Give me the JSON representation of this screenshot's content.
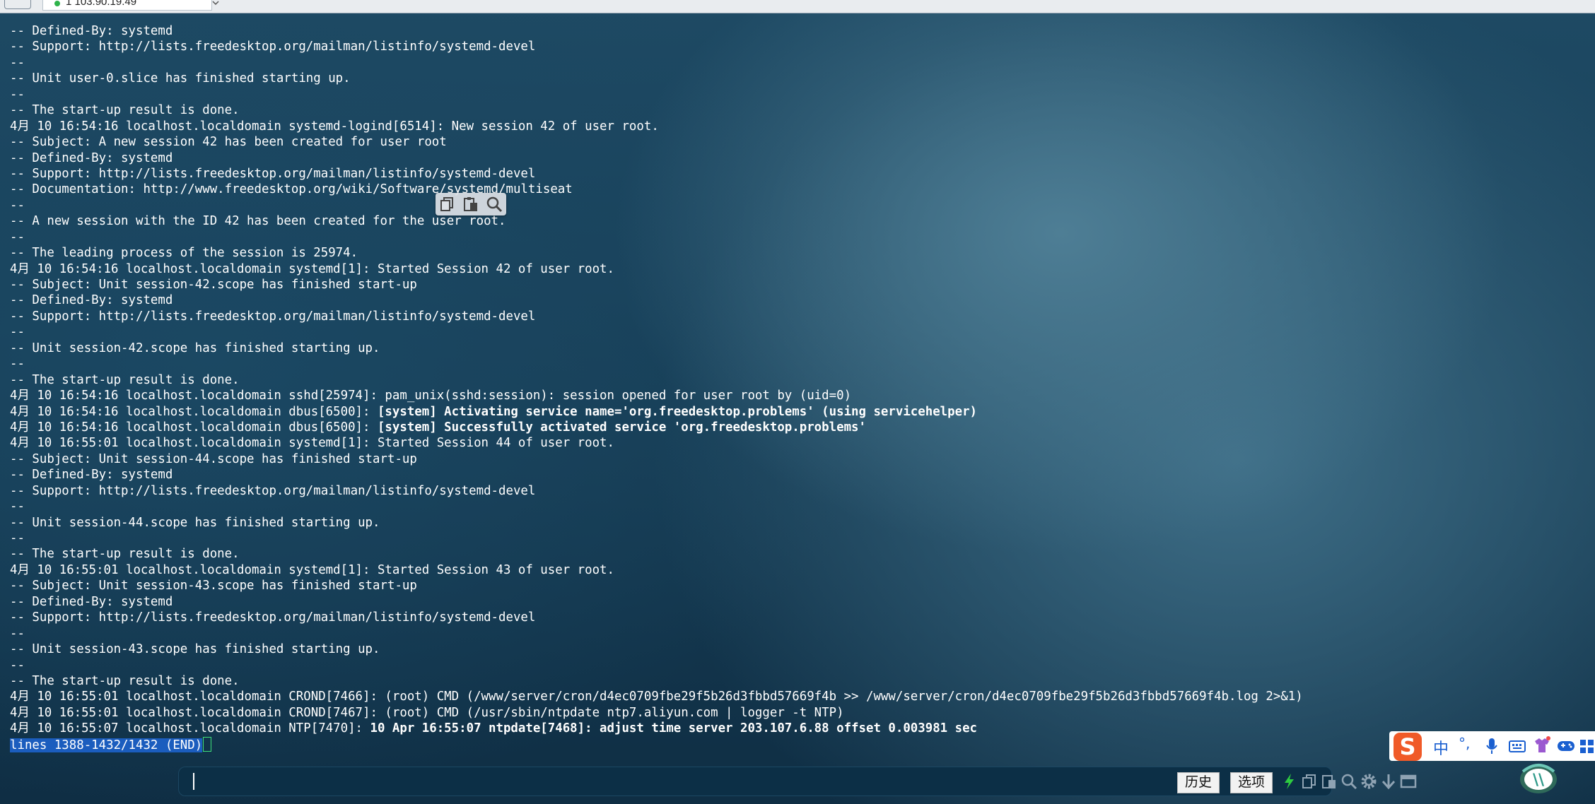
{
  "window": {
    "tab_title": "1 103.90.19.49",
    "active_tab_status_color": "#2fb34a"
  },
  "terminal": {
    "lines": [
      {
        "text": "-- Defined-By: systemd"
      },
      {
        "text": "-- Support: http://lists.freedesktop.org/mailman/listinfo/systemd-devel"
      },
      {
        "text": "--"
      },
      {
        "text": "-- Unit user-0.slice has finished starting up."
      },
      {
        "text": "--"
      },
      {
        "text": "-- The start-up result is done."
      },
      {
        "text": "4月 10 16:54:16 localhost.localdomain systemd-logind[6514]: New session 42 of user root."
      },
      {
        "text": "-- Subject: A new session 42 has been created for user root"
      },
      {
        "text": "-- Defined-By: systemd"
      },
      {
        "text": "-- Support: http://lists.freedesktop.org/mailman/listinfo/systemd-devel"
      },
      {
        "text": "-- Documentation: http://www.freedesktop.org/wiki/Software/systemd/multiseat"
      },
      {
        "text": "--"
      },
      {
        "text": "-- A new session with the ID 42 has been created for the user root."
      },
      {
        "text": "--"
      },
      {
        "text": "-- The leading process of the session is 25974."
      },
      {
        "text": "4月 10 16:54:16 localhost.localdomain systemd[1]: Started Session 42 of user root."
      },
      {
        "text": "-- Subject: Unit session-42.scope has finished start-up"
      },
      {
        "text": "-- Defined-By: systemd"
      },
      {
        "text": "-- Support: http://lists.freedesktop.org/mailman/listinfo/systemd-devel"
      },
      {
        "text": "--"
      },
      {
        "text": "-- Unit session-42.scope has finished starting up."
      },
      {
        "text": "--"
      },
      {
        "text": "-- The start-up result is done."
      },
      {
        "text": "4月 10 16:54:16 localhost.localdomain sshd[25974]: pam_unix(sshd:session): session opened for user root by (uid=0)"
      },
      {
        "prefix": "4月 10 16:54:16 localhost.localdomain dbus[6500]: ",
        "bold": "[system] Activating service name='org.freedesktop.problems' (using servicehelper)"
      },
      {
        "prefix": "4月 10 16:54:16 localhost.localdomain dbus[6500]: ",
        "bold": "[system] Successfully activated service 'org.freedesktop.problems'"
      },
      {
        "text": "4月 10 16:55:01 localhost.localdomain systemd[1]: Started Session 44 of user root."
      },
      {
        "text": "-- Subject: Unit session-44.scope has finished start-up"
      },
      {
        "text": "-- Defined-By: systemd"
      },
      {
        "text": "-- Support: http://lists.freedesktop.org/mailman/listinfo/systemd-devel"
      },
      {
        "text": "--"
      },
      {
        "text": "-- Unit session-44.scope has finished starting up."
      },
      {
        "text": "--"
      },
      {
        "text": "-- The start-up result is done."
      },
      {
        "text": "4月 10 16:55:01 localhost.localdomain systemd[1]: Started Session 43 of user root."
      },
      {
        "text": "-- Subject: Unit session-43.scope has finished start-up"
      },
      {
        "text": "-- Defined-By: systemd"
      },
      {
        "text": "-- Support: http://lists.freedesktop.org/mailman/listinfo/systemd-devel"
      },
      {
        "text": "--"
      },
      {
        "text": "-- Unit session-43.scope has finished starting up."
      },
      {
        "text": "--"
      },
      {
        "text": "-- The start-up result is done."
      },
      {
        "text": "4月 10 16:55:01 localhost.localdomain CROND[7466]: (root) CMD (/www/server/cron/d4ec0709fbe29f5b26d3fbbd57669f4b >> /www/server/cron/d4ec0709fbe29f5b26d3fbbd57669f4b.log 2>&1)"
      },
      {
        "text": "4月 10 16:55:01 localhost.localdomain CROND[7467]: (root) CMD (/usr/sbin/ntpdate ntp7.aliyun.com | logger -t NTP)"
      },
      {
        "prefix": "4月 10 16:55:07 localhost.localdomain NTP[7470]: ",
        "bold": "10 Apr 16:55:07 ntpdate[7468]: adjust time server 203.107.6.88 offset 0.003981 sec"
      }
    ],
    "status_line": "lines 1388-1432/1432 (END)",
    "status_highlight_color": "#1b5dbe",
    "cursor_color": "#3fe07a"
  },
  "selection_toolbar": {
    "icons": [
      "copy-icon",
      "paste-icon",
      "search-icon"
    ]
  },
  "input_bar": {
    "history_label": "历史",
    "options_label": "选项",
    "icons": [
      "lightning-icon",
      "copy-icon",
      "paste-icon",
      "search-icon",
      "gear-icon",
      "download-arrow-icon",
      "window-icon"
    ],
    "lightning_color": "#2ecc40"
  },
  "ime_bar": {
    "logo": "sogou-s-icon",
    "mode_label": "中",
    "punctuation_label": "°,",
    "icons": [
      "microphone-icon",
      "keyboard-icon",
      "skin-icon",
      "gamepad-icon",
      "grid-icon"
    ],
    "brand_color": "#f05a28"
  }
}
